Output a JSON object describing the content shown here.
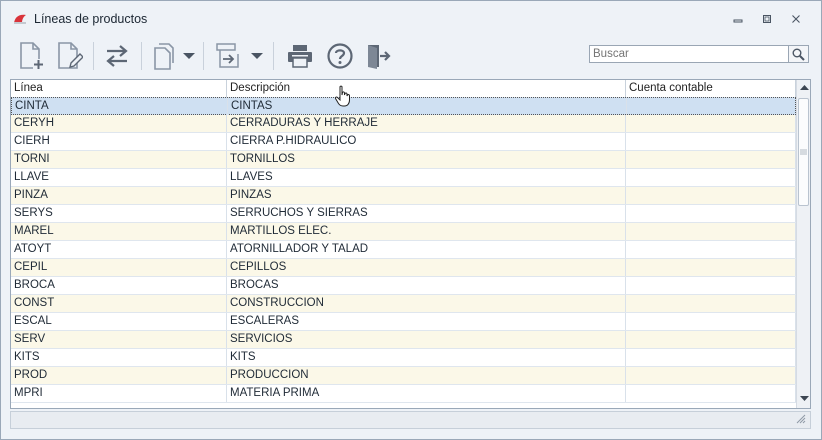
{
  "window": {
    "title": "Líneas de productos"
  },
  "search": {
    "placeholder": "Buscar"
  },
  "toolbar": {
    "icons": [
      "new-document",
      "edit-document",
      "transfer",
      "copy",
      "dropdown",
      "export",
      "dropdown",
      "print",
      "help",
      "exit"
    ]
  },
  "grid": {
    "columns": [
      "Línea",
      "Descripción",
      "Cuenta contable"
    ],
    "rows": [
      {
        "linea": "CINTA",
        "descripcion": "CINTAS",
        "cuenta": ""
      },
      {
        "linea": "CERYH",
        "descripcion": "CERRADURAS Y HERRAJE",
        "cuenta": ""
      },
      {
        "linea": "CIERH",
        "descripcion": "CIERRA P.HIDRAULICO",
        "cuenta": ""
      },
      {
        "linea": "TORNI",
        "descripcion": "TORNILLOS",
        "cuenta": ""
      },
      {
        "linea": "LLAVE",
        "descripcion": "LLAVES",
        "cuenta": ""
      },
      {
        "linea": "PINZA",
        "descripcion": "PINZAS",
        "cuenta": ""
      },
      {
        "linea": "SERYS",
        "descripcion": "SERRUCHOS Y SIERRAS",
        "cuenta": ""
      },
      {
        "linea": "MAREL",
        "descripcion": "MARTILLOS ELEC.",
        "cuenta": ""
      },
      {
        "linea": "ATOYT",
        "descripcion": "ATORNILLADOR Y TALAD",
        "cuenta": ""
      },
      {
        "linea": "CEPIL",
        "descripcion": "CEPILLOS",
        "cuenta": ""
      },
      {
        "linea": "BROCA",
        "descripcion": "BROCAS",
        "cuenta": ""
      },
      {
        "linea": "CONST",
        "descripcion": "CONSTRUCCION",
        "cuenta": ""
      },
      {
        "linea": "ESCAL",
        "descripcion": "ESCALERAS",
        "cuenta": ""
      },
      {
        "linea": "SERV",
        "descripcion": "SERVICIOS",
        "cuenta": ""
      },
      {
        "linea": "KITS",
        "descripcion": "KITS",
        "cuenta": ""
      },
      {
        "linea": "PROD",
        "descripcion": "PRODUCCION",
        "cuenta": ""
      },
      {
        "linea": "MPRI",
        "descripcion": "MATERIA PRIMA",
        "cuenta": ""
      }
    ],
    "selected_index": 0
  },
  "colors": {
    "window_bg": "#eef2f7",
    "row_alt": "#fbf8e8",
    "row_selected": "#cfe0f2",
    "icon_gray": "#8a96a6",
    "icon_dark": "#5d6775",
    "app_icon_red": "#d9333a"
  }
}
